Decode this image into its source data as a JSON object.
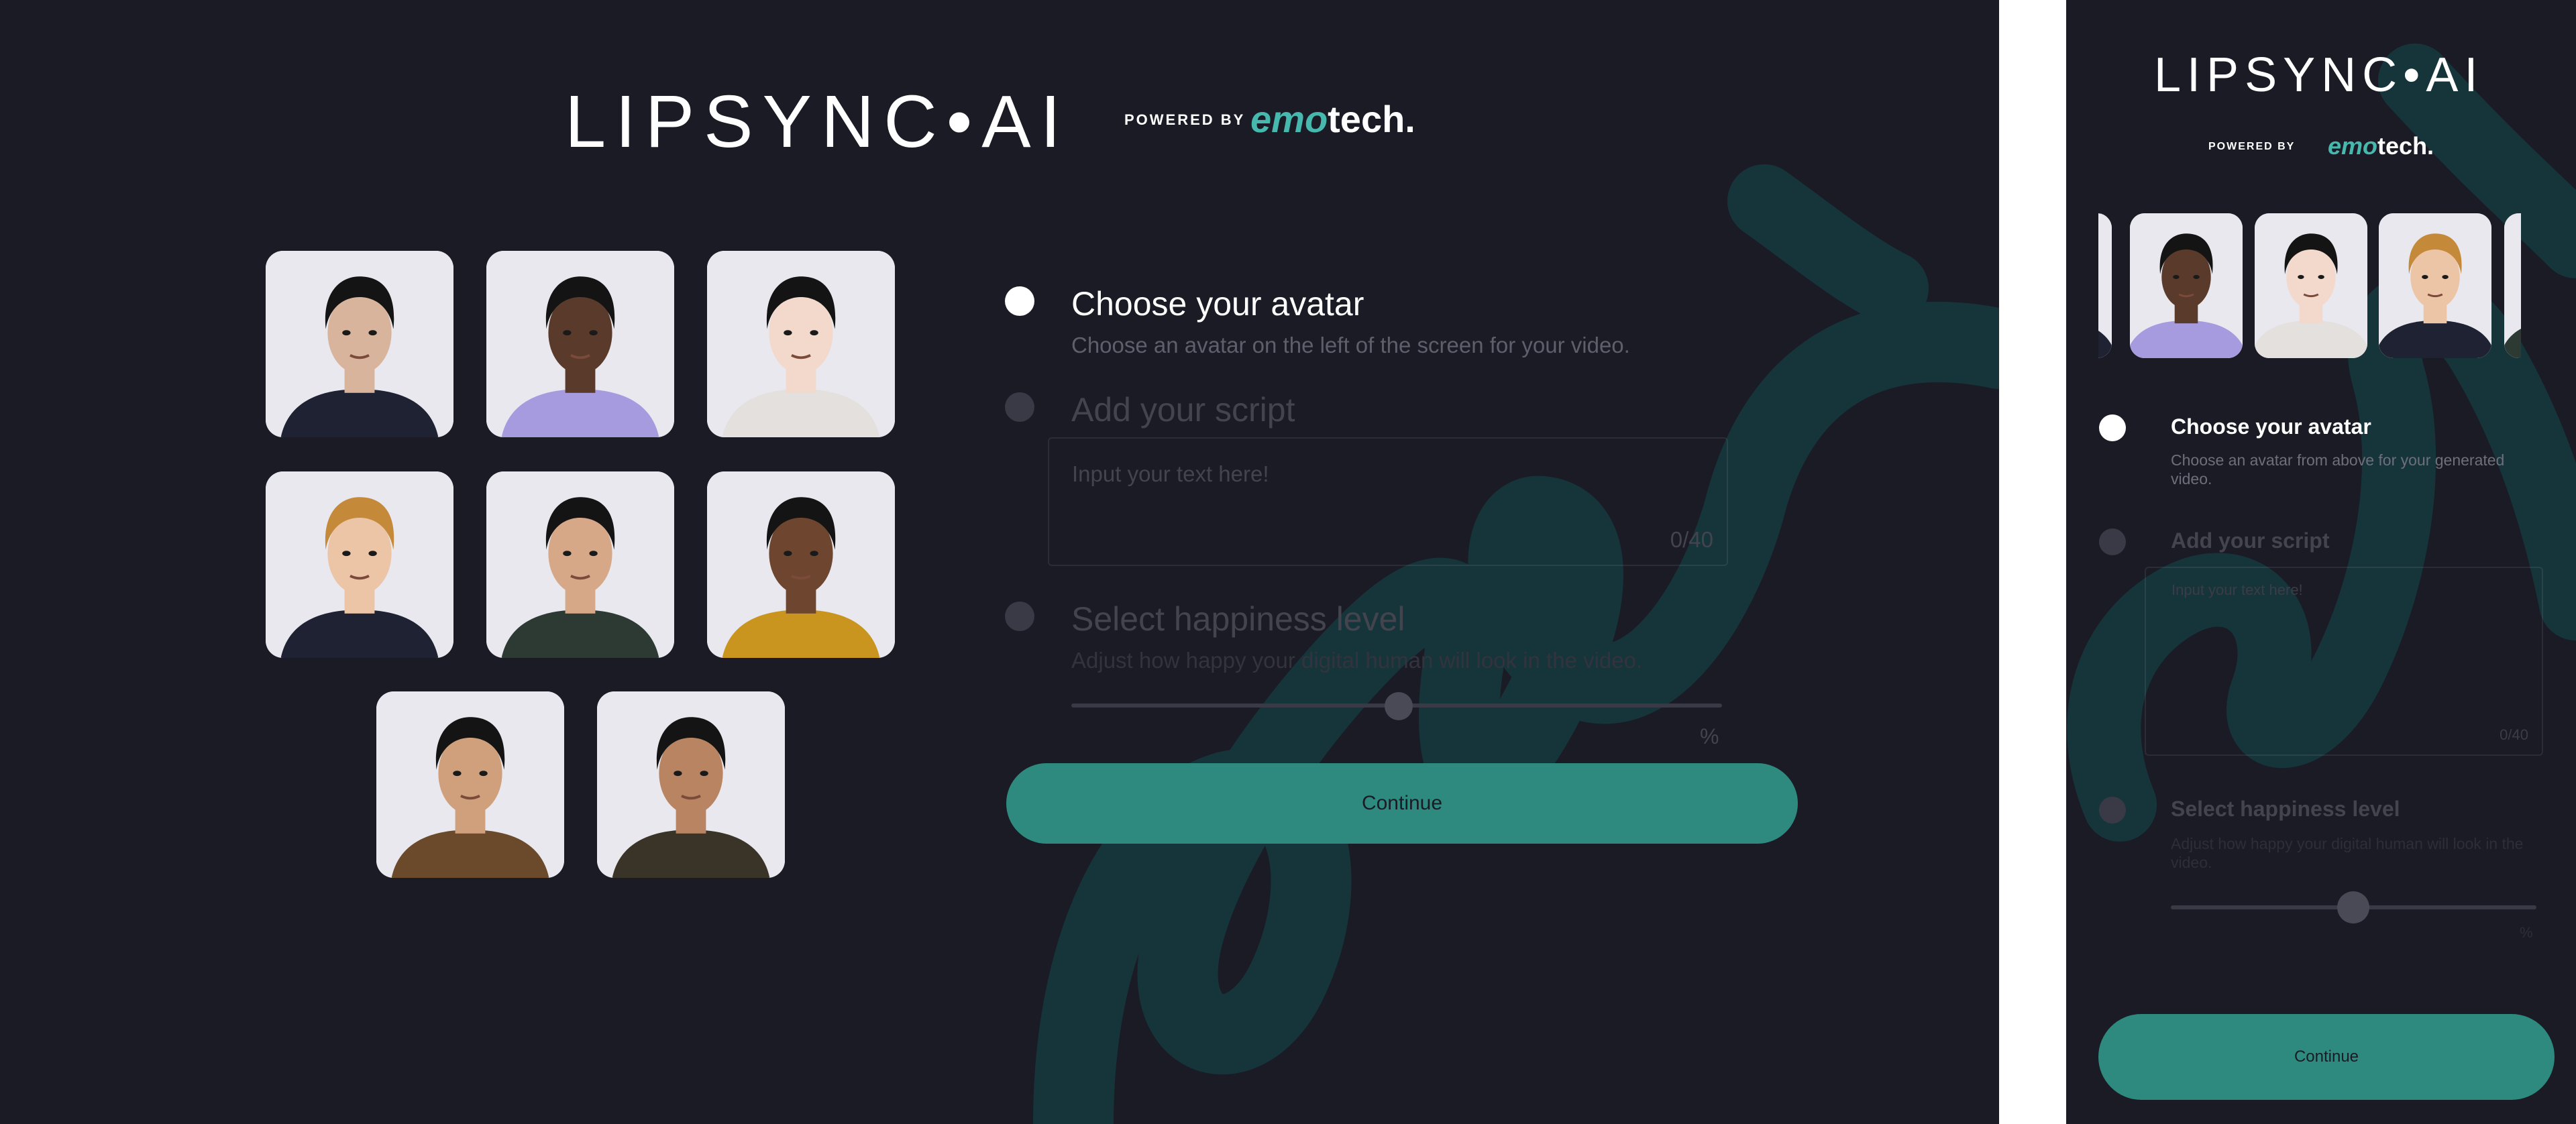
{
  "brand": {
    "logo_text": "LIPSYNC•AI",
    "powered_by": "POWERED BY",
    "emotech_em": "emo",
    "emotech_tech": "tech."
  },
  "desktop": {
    "steps": {
      "avatar_title": "Choose your avatar",
      "avatar_desc": "Choose an avatar on the left of the screen for your video.",
      "script_title": "Add your script",
      "script_placeholder": "Input your text here!",
      "script_count": "0/40",
      "happiness_title": "Select happiness level",
      "happiness_desc": "Adjust how happy your digital human will look in the video.",
      "happiness_unit": "%"
    },
    "continue_label": "Continue"
  },
  "mobile": {
    "steps": {
      "avatar_title": "Choose your avatar",
      "avatar_desc": "Choose an avatar from above for your generated video.",
      "script_title": "Add your script",
      "script_placeholder": "Input your text here!",
      "script_count": "0/40",
      "happiness_title": "Select happiness level",
      "happiness_desc": "Adjust how happy your digital human will look in the video.",
      "happiness_unit": "%"
    },
    "continue_label": "Continue"
  },
  "avatars": [
    {
      "id": "avatar-1",
      "skin": "#d8b49c",
      "hair": "#141414",
      "shirt": "#1e2233"
    },
    {
      "id": "avatar-2",
      "skin": "#5a3b2b",
      "hair": "#141414",
      "shirt": "#a79be0"
    },
    {
      "id": "avatar-3",
      "skin": "#f2d9cc",
      "hair": "#141414",
      "shirt": "#e3e0dd"
    },
    {
      "id": "avatar-4",
      "skin": "#ecc4a6",
      "hair": "#c5893a",
      "shirt": "#1e2233"
    },
    {
      "id": "avatar-5",
      "skin": "#d6a888",
      "hair": "#141414",
      "shirt": "#2c3a33"
    },
    {
      "id": "avatar-6",
      "skin": "#6e4630",
      "hair": "#141414",
      "shirt": "#c9951f"
    },
    {
      "id": "avatar-7",
      "skin": "#d0a07c",
      "hair": "#141414",
      "shirt": "#6a4a2a"
    },
    {
      "id": "avatar-8",
      "skin": "#b88462",
      "hair": "#141414",
      "shirt": "#3a3428"
    }
  ],
  "colors": {
    "background": "#1b1b26",
    "accent": "#2e8a7e",
    "brand_teal": "#46b8ad"
  },
  "slider": {
    "happiness_level": 0.5
  }
}
